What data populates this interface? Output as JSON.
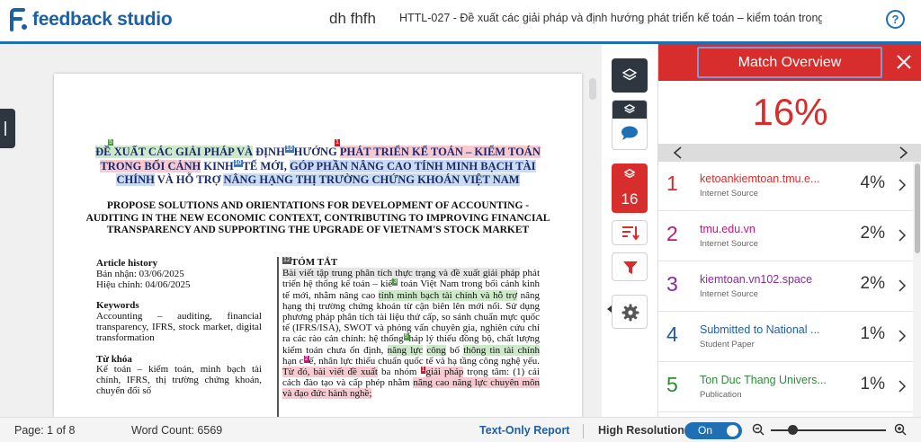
{
  "header": {
    "brand": "feedback studio",
    "user_name": "dh fhfh",
    "document_title": "HTTL-027 - Đề xuất các giải pháp và định hướng phát triển kế toán – kiểm toán trong ...",
    "help_label": "?"
  },
  "document": {
    "vi_title": {
      "p1": "Đề xuất các giải pháp và",
      "p2": " định",
      "p3": "hướng ",
      "p4": "phát triển kế toán – kiểm toán",
      "p5": "trong bối cảnh",
      "p6": " kinh",
      "p7": "tế mới, ",
      "p8": "góp phần nâng cao tính minh bạch tài",
      "p9": "chính",
      "p10": " và hỗ trợ ",
      "p11": "nâng hạng thị trường chứng khoán Việt Nam",
      "tag_a": "5",
      "tag_b": "1",
      "tag_c": "10",
      "tag_d": "10"
    },
    "en_title": "PROPOSE SOLUTIONS AND ORIENTATIONS FOR DEVELOPMENT OF ACCOUNTING - AUDITING IN THE NEW ECONOMIC CONTEXT, CONTRIBUTING TO IMPROVING FINANCIAL TRANSPARENCY AND SUPPORTING THE UPGRADE OF VIETNAM'S STOCK MARKET",
    "history": {
      "heading": "Article history",
      "received": "Bản nhận: 03/06/2025",
      "revised": "Hiệu chỉnh: 04/06/2025",
      "keywords_heading": "Keywords",
      "keywords": "Accounting – auditing, financial transparency, IFRS, stock market, digital transformation",
      "vi_keywords_heading": "Từ khóa",
      "vi_keywords": "Kế toán – kiểm toán, minh bạch tài chính, IFRS, thị trường chứng khoán, chuyển đổi số"
    },
    "abstract": {
      "tag": "12",
      "heading": "TÓM TẮT",
      "a1": "Bài viết tập trung phân tích thực trạng và đề xuất giải pháp",
      "a2": " phát triển hệ thống kế toán – kiể",
      "tag_b": "3",
      "a3": " toán Việt Nam trong bối cảnh kinh tế mới, nhằm nâng cao ",
      "a4": "tính minh bạch tài chính và hỗ trợ",
      "a5": " nâng hạng thị trường chứng khoán từ cận biên lên mới nổi. Sử dụng phương pháp phân tích tài liệu thứ cấp, so sánh chuẩn mực quốc tế (IFRS/ISA), SWOT và phỏng vấn chuyên gia, nghiên cứu chỉ ra các rào cản chính: hệ thống",
      "tag_c": "5",
      "a6": "háp lý thiếu đồng bộ, chất lượng kiểm toán chưa ổn định, ",
      "a7": "năng lực",
      "a8": "công",
      "a9": " bố ",
      "a10": "thông tin tài chính",
      "a11": " hạn c",
      "tag_d": "2",
      "a12": "ế, nhân lực thiếu chuẩn quốc tế và hạ tầng công nghệ yếu. ",
      "a13": "Từ đó, bài viết đề xuất",
      "a14": " ba nhóm ",
      "tag_e": "1",
      "a15": "giải pháp",
      "a16": " trọng tâm: (1) cải cách đào tạo và cấp phép nhằm ",
      "a17": "nâng cao năng lực chuyên môn và đạo đức hành nghề;"
    }
  },
  "toolbar": {
    "match_count": "16",
    "icons": [
      "layers-icon",
      "comment-icon",
      "match-layers-icon",
      "sort-icon",
      "filter-icon",
      "gear-icon"
    ]
  },
  "panel": {
    "title": "Match Overview",
    "overall": "16%",
    "matches": [
      {
        "num": "1",
        "source": "ketoankiemtoan.tmu.e...",
        "type": "Internet Source",
        "pct": "4%",
        "color": "#d82d2d"
      },
      {
        "num": "2",
        "source": "tmu.edu.vn",
        "type": "Internet Source",
        "pct": "2%",
        "color": "#c2177a"
      },
      {
        "num": "3",
        "source": "kiemtoan.vn102.space",
        "type": "Internet Source",
        "pct": "2%",
        "color": "#8a2a9c"
      },
      {
        "num": "4",
        "source": "Submitted to National ...",
        "type": "Student Paper",
        "pct": "1%",
        "color": "#1f5fa8"
      },
      {
        "num": "5",
        "source": "Ton Duc Thang Univers...",
        "type": "Publication",
        "pct": "1%",
        "color": "#2e8b3a"
      }
    ]
  },
  "status": {
    "page": "Page: 1 of 8",
    "words": "Word Count: 6569",
    "text_only": "Text-Only Report",
    "high_res": "High Resolution",
    "toggle": "On"
  },
  "colors": {
    "brand_blue": "#1f6fb5",
    "match_red": "#d82d2d",
    "dark_tool": "#2e3640"
  }
}
